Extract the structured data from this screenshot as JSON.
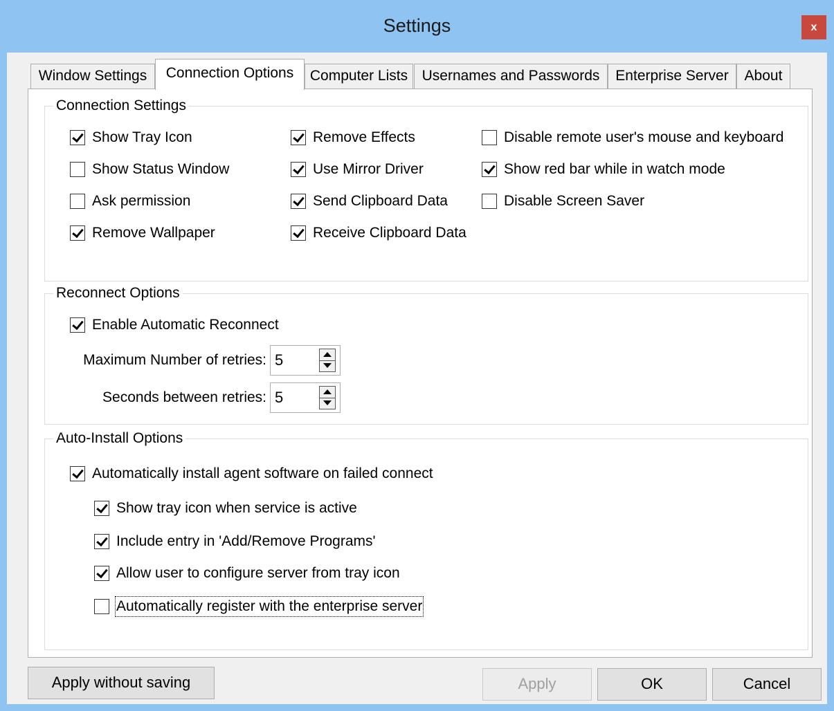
{
  "window": {
    "title": "Settings",
    "close_glyph": "x"
  },
  "tabs": [
    {
      "label": "Window Settings"
    },
    {
      "label": "Connection Options",
      "active": true
    },
    {
      "label": "Computer Lists"
    },
    {
      "label": "Usernames and Passwords"
    },
    {
      "label": "Enterprise Server"
    },
    {
      "label": "About"
    }
  ],
  "connection_settings": {
    "legend": "Connection Settings",
    "options": [
      {
        "label": "Show Tray Icon",
        "checked": true
      },
      {
        "label": "Show Status Window",
        "checked": false
      },
      {
        "label": "Ask permission",
        "checked": false
      },
      {
        "label": "Remove Wallpaper",
        "checked": true
      },
      {
        "label": "Remove Effects",
        "checked": true
      },
      {
        "label": "Use Mirror Driver",
        "checked": true
      },
      {
        "label": "Send Clipboard Data",
        "checked": true
      },
      {
        "label": "Receive Clipboard Data",
        "checked": true
      },
      {
        "label": "Disable remote user's mouse and keyboard",
        "checked": false
      },
      {
        "label": "Show red bar while in watch mode",
        "checked": true
      },
      {
        "label": "Disable Screen Saver",
        "checked": false
      }
    ]
  },
  "reconnect_options": {
    "legend": "Reconnect Options",
    "enable": {
      "label": "Enable Automatic Reconnect",
      "checked": true
    },
    "max_retries": {
      "label": "Maximum Number of retries:",
      "value": "5"
    },
    "seconds_between": {
      "label": "Seconds between retries:",
      "value": "5"
    }
  },
  "auto_install": {
    "legend": "Auto-Install Options",
    "main": {
      "label": "Automatically install agent software on failed connect",
      "checked": true
    },
    "sub": [
      {
        "label": "Show tray icon when service is active",
        "checked": true
      },
      {
        "label": "Include entry in 'Add/Remove Programs'",
        "checked": true
      },
      {
        "label": "Allow user to configure server from tray icon",
        "checked": true
      },
      {
        "label": "Automatically register with the enterprise server",
        "checked": false
      }
    ]
  },
  "buttons": {
    "apply_without_saving": "Apply without saving",
    "apply": "Apply",
    "ok": "OK",
    "cancel": "Cancel"
  },
  "colors": {
    "frame": "#8fc4f2",
    "close_button": "#c9483d",
    "annotation_arrow": "#1a1a1a"
  }
}
